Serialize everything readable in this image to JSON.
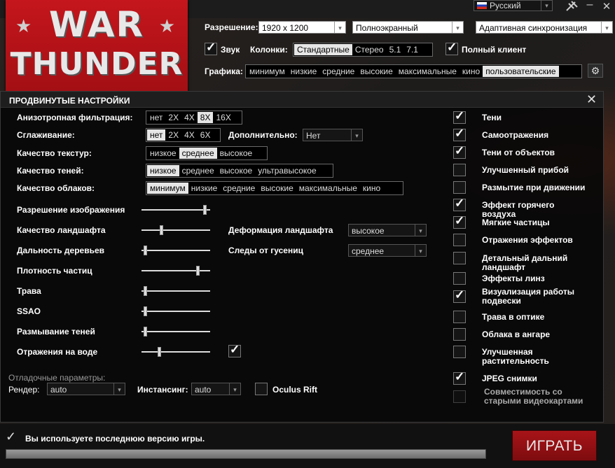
{
  "logo": {
    "line1": "WAR",
    "line2": "THUNDER",
    "star": "★"
  },
  "window": {
    "language": "Русский",
    "chevron": "▾",
    "flag_colors": [
      "#ffffff",
      "#1c3fbf",
      "#d52b1e"
    ],
    "minimize_label": "–",
    "close_label": "✕"
  },
  "top_settings": {
    "resolution_label": "Разрешение:",
    "resolution_value": "1920 x 1200",
    "mode_value": "Полноэкранный",
    "vsync_value": "Адаптивная синхронизация",
    "sound_label": "Звук",
    "sound_checked": true,
    "speakers_label": "Колонки:",
    "speakers_options": [
      "Стандартные",
      "Стерео",
      "5.1",
      "7.1"
    ],
    "speakers_selected": "Стандартные",
    "full_client_label": "Полный клиент",
    "full_client_checked": true,
    "graphics_label": "Графика:",
    "graphics_options": [
      "минимум",
      "низкие",
      "средние",
      "высокие",
      "максимальные",
      "кино",
      "пользовательские"
    ],
    "graphics_selected": "пользовательские"
  },
  "advanced": {
    "title": "ПРОДВИНУТЫЕ НАСТРОЙКИ",
    "close": "✕",
    "anisotropic": {
      "label": "Анизотропная фильтрация:",
      "options": [
        "нет",
        "2X",
        "4X",
        "8X",
        "16X"
      ],
      "selected": "8X"
    },
    "antialiasing": {
      "label": "Сглаживание:",
      "options": [
        "нет",
        "2X",
        "4X",
        "6X"
      ],
      "selected": "нет"
    },
    "extra": {
      "label": "Дополнительно:",
      "value": "Нет"
    },
    "texture": {
      "label": "Качество текстур:",
      "options": [
        "низкое",
        "среднее",
        "высокое"
      ],
      "selected": "среднее"
    },
    "shadow": {
      "label": "Качество теней:",
      "options": [
        "низкое",
        "среднее",
        "высокое",
        "ультравысокое"
      ],
      "selected": "низкое"
    },
    "clouds": {
      "label": "Качество облаков:",
      "options": [
        "минимум",
        "низкие",
        "средние",
        "высокие",
        "максимальные",
        "кино"
      ],
      "selected": "минимум"
    },
    "sliders": [
      {
        "label": "Разрешение изображения",
        "value": 0.95
      },
      {
        "label": "Качество ландшафта",
        "value": 0.28
      },
      {
        "label": "Дальность деревьев",
        "value": 0.03
      },
      {
        "label": "Плотность частиц",
        "value": 0.84
      },
      {
        "label": "Трава",
        "value": 0.03
      },
      {
        "label": "SSAO",
        "value": 0.03
      },
      {
        "label": "Размывание теней",
        "value": 0.03
      },
      {
        "label": "Отражения на воде",
        "value": 0.25
      }
    ],
    "water_reflection_checked": true,
    "terrain_deform": {
      "label": "Деформация ландшафта",
      "value": "высокое"
    },
    "tracks": {
      "label": "Следы от гусениц",
      "value": "среднее"
    },
    "debug_label": "Отладочные параметры:",
    "render": {
      "label": "Рендер:",
      "value": "auto"
    },
    "instancing": {
      "label": "Инстансинг:",
      "value": "auto"
    },
    "oculus": {
      "label": "Oculus Rift",
      "checked": false
    },
    "toggles": [
      {
        "label": "Тени",
        "checked": true
      },
      {
        "label": "Самоотражения",
        "checked": true
      },
      {
        "label": "Тени от объектов",
        "checked": true
      },
      {
        "label": "Улучшенный прибой",
        "checked": false
      },
      {
        "label": "Размытие при движении",
        "checked": false
      },
      {
        "label": "Эффект горячего воздуха",
        "checked": true
      },
      {
        "label": "Мягкие частицы",
        "checked": true
      },
      {
        "label": "Отражения эффектов",
        "checked": false
      },
      {
        "label": "Детальный дальний ландшафт",
        "checked": false
      },
      {
        "label": "Эффекты линз",
        "checked": false
      },
      {
        "label": "Визуализация работы подвески",
        "checked": true
      },
      {
        "label": "Трава в оптике",
        "checked": false
      },
      {
        "label": "Облака в ангаре",
        "checked": false
      },
      {
        "label": "Улучшенная растительность",
        "checked": false
      },
      {
        "label": "JPEG снимки",
        "checked": true
      },
      {
        "label": "Совместимость со старыми видеокартами",
        "checked": false,
        "disabled": true
      }
    ]
  },
  "status": {
    "check": "✓",
    "text": "Вы используете последнюю версию игры.",
    "progress": 1.0
  },
  "play_label": "ИГРАТЬ"
}
